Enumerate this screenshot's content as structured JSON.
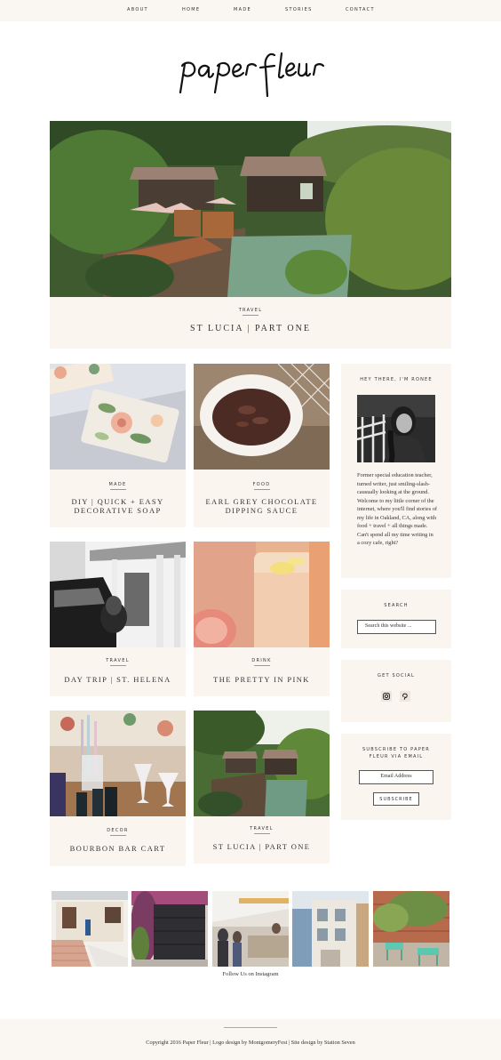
{
  "nav": {
    "items": [
      "About",
      "Home",
      "Made",
      "Stories",
      "Contact"
    ]
  },
  "logo": {
    "text": "paper fleur"
  },
  "featured": {
    "category": "Travel",
    "title": "St Lucia | Part One"
  },
  "posts": [
    {
      "category": "Made",
      "title": "DIY | Quick + Easy Decorative Soap"
    },
    {
      "category": "Food",
      "title": "Earl Grey Chocolate Dipping Sauce"
    },
    {
      "category": "Travel",
      "title": "Day Trip | St. Helena"
    },
    {
      "category": "Drink",
      "title": "The Pretty in Pink"
    },
    {
      "category": "Decor",
      "title": "Bourbon Bar Cart"
    },
    {
      "category": "Travel",
      "title": "St Lucia | Part One"
    }
  ],
  "sidebar": {
    "about": {
      "heading": "Hey there, I'm Ronee",
      "text": "Former special education teacher, turned writer, just smiling-slash-causually looking at the ground. Welcome to my little corner of the internet, where you'll find stories of my life in Oakland, CA, along with food + travel + all things made. Can't spend all my time writing in a cozy cafe, right?"
    },
    "search": {
      "heading": "Search",
      "placeholder": "Search this website ..."
    },
    "social": {
      "heading": "Get Social",
      "icons": [
        "instagram-icon",
        "pinterest-icon"
      ]
    },
    "subscribe": {
      "heading": "Subscribe to Paper Fleur via Email",
      "placeholder": "Email Address",
      "button": "Subscribe"
    }
  },
  "instagram": {
    "caption": "Follow Us on Instagram"
  },
  "footer": {
    "copyright": "Copyright 2016 Paper Fleur | Logo design by MontgomeryFest | Site design by Station Seven"
  }
}
